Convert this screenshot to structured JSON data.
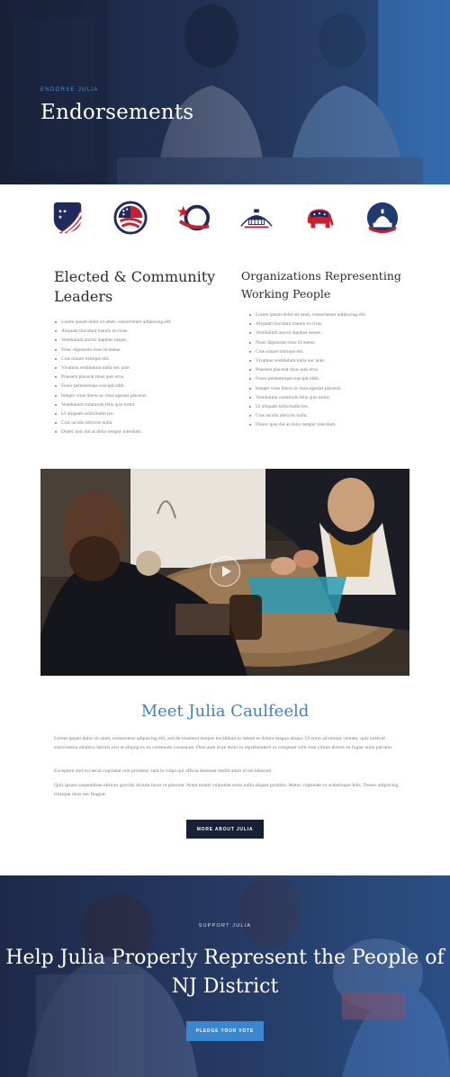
{
  "hero": {
    "eyebrow": "ENDORSE JULIA",
    "title": "Endorsements"
  },
  "logos": [
    {
      "icon": "flag-shield-icon"
    },
    {
      "icon": "flag-globe-icon"
    },
    {
      "icon": "star-swoosh-icon"
    },
    {
      "icon": "capitol-dome-icon"
    },
    {
      "icon": "elephant-icon"
    },
    {
      "icon": "capitol-circle-icon"
    }
  ],
  "leaders": {
    "title": "Elected & Community Leaders",
    "items": [
      "Lorem ipsum dolor sit amet, consectetuer adipiscing elit.",
      "Aliquam tincidunt mauris eu risus.",
      "Vestibulum auctor dapibus neque.",
      "Nunc dignissim risus id metus.",
      "Cras ornare tristique elit.",
      "Vivamus vestibulum nulla nec ante.",
      "Praesent placerat risus quis eros.",
      "Fusce pellentesque suscipit nibh.",
      "Integer vitae libero ac risus egestas placerat.",
      "Vestibulum commodo felis quis tortor.",
      "Ut aliquam sollicitudin leo.",
      "Cras iaculis ultricies nulla.",
      "Donec quis dui at dolor tempor interdum."
    ]
  },
  "organizations": {
    "title": "Organizations Representing Working People",
    "items": [
      "Lorem ipsum dolor sit amet, consectetuer adipiscing elit.",
      "Aliquam tincidunt mauris eu risus.",
      "Vestibulum auctor dapibus neque.",
      "Nunc dignissim risus id metus.",
      "Cras ornare tristique elit.",
      "Vivamus vestibulum nulla nec ante.",
      "Praesent placerat risus quis eros.",
      "Fusce pellentesque suscipit nibh.",
      "Integer vitae libero ac risus egestas placerat.",
      "Vestibulum commodo felis quis tortor.",
      "Ut aliquam sollicitudin leo.",
      "Cras iaculis ultricies nulla.",
      "Donec quis dui at dolor tempor interdum."
    ]
  },
  "video": {
    "play_icon": "play-icon"
  },
  "meet": {
    "title": "Meet Julia Caulfeeld",
    "p1": "Lorem ipsum dolor sit amet, consectetur adipiscing elit, sed do eiusmod tempor incididunt ut labore et dolore magna aliqua. Ut enim ad minim veniam, quis nostrud exercitation ullamco laboris nisi ut aliquip ex ea commodo consequat. Duis aute irure dolor in reprehenderit in voluptate velit esse cillum dolore eu fugiat nulla pariatur.",
    "p2": "Excepteur sint occaecat cupidatat non proident, sunt in culpa qui officia deserunt mollit anim id est laborum",
    "p3": "Quis ipsum suspendisse ultrices gravida dictum fusce ut placerat. Amet mattis vulputate enim nulla aliquet porttitor. Metus vulputate eu scelerisque felis. Donec adipiscing tristique risus nec feugiat.",
    "button": "MORE ABOUT JULIA"
  },
  "support": {
    "eyebrow": "SUPPORT JULIA",
    "title": "Help Julia Properly Represent the People of NJ District",
    "button": "PLEDGE YOUR VOTE"
  },
  "colors": {
    "accent_blue": "#3a82cc",
    "navy": "#182038",
    "button_blue": "#3a86d0"
  }
}
